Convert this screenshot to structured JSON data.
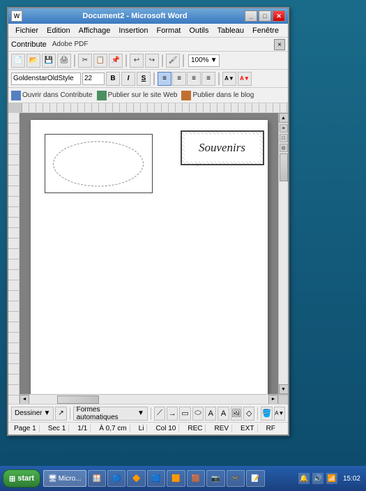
{
  "window": {
    "title": "Document2 - Microsoft Word",
    "title_icon": "W"
  },
  "menu": {
    "items": [
      "Fichier",
      "Edition",
      "Affichage",
      "Insertion",
      "Format",
      "Outils",
      "Tableau",
      "Fenêtre"
    ]
  },
  "contribute_bar": {
    "label": "Contribute",
    "adobe_pdf": "Adobe PDF",
    "close": "×"
  },
  "toolbar1": {
    "zoom": "100%",
    "zoom_arrow": "▼"
  },
  "toolbar2": {
    "font": "GoldenstarOldStyle",
    "size": "22",
    "bold": "B",
    "italic": "I",
    "underline": "S"
  },
  "contribute_toolbar": {
    "open_contribute": "Ouvrir dans Contribute",
    "publish_web": "Publier sur le site Web",
    "publish_blog": "Publier dans le blog"
  },
  "canvas": {
    "souvenirs_text": "Souvenirs"
  },
  "draw_toolbar": {
    "dessiner": "Dessiner",
    "formes": "Formes automatiques",
    "arrow_down": "▼"
  },
  "status_bar": {
    "page": "Page  1",
    "sec": "Sec  1",
    "pages": "1/1",
    "position": "À 0,7 cm",
    "col": "Col 10",
    "li": "Li",
    "rec": "REC",
    "rev": "REV",
    "ext": "EXT",
    "rf": "RF"
  },
  "taskbar": {
    "apps": [
      {
        "label": "Micro...",
        "icon": "🖥"
      },
      {
        "label": "",
        "icon": "🪟"
      },
      {
        "label": "",
        "icon": "🔵"
      },
      {
        "label": "",
        "icon": "🔶"
      },
      {
        "label": "",
        "icon": "🟦"
      },
      {
        "label": "",
        "icon": "🟧"
      },
      {
        "label": "",
        "icon": "🟫"
      },
      {
        "label": "",
        "icon": "📷"
      },
      {
        "label": "",
        "icon": "🎮"
      },
      {
        "label": "",
        "icon": "📝"
      }
    ],
    "clock": "15:02"
  }
}
